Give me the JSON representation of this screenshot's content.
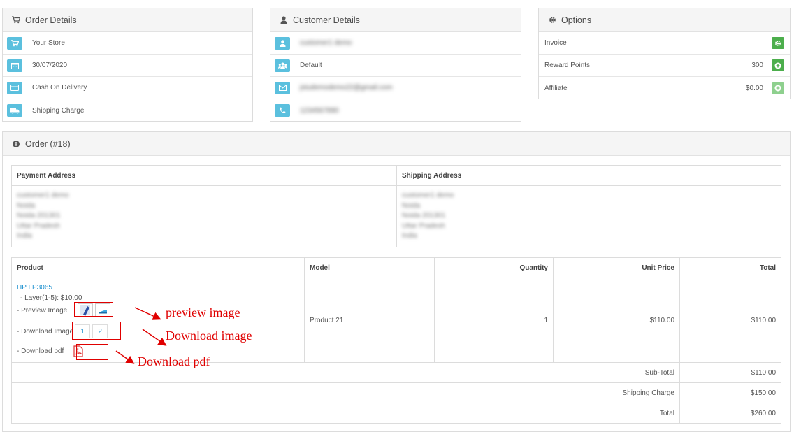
{
  "order_details": {
    "title": "Order Details",
    "store": "Your Store",
    "date": "30/07/2020",
    "payment_method": "Cash On Delivery",
    "shipping_method": "Shipping Charge"
  },
  "customer_details": {
    "title": "Customer Details",
    "name": "customer1 demo",
    "group": "Default",
    "email": "jstudemodemo22@gmail.com",
    "phone": "1234567890"
  },
  "options": {
    "title": "Options",
    "invoice_label": "Invoice",
    "reward_label": "Reward Points",
    "reward_value": "300",
    "affiliate_label": "Affiliate",
    "affiliate_value": "$0.00"
  },
  "order": {
    "title": "Order (#18)",
    "payment_address_header": "Payment Address",
    "shipping_address_header": "Shipping Address",
    "payment_address_lines": [
      "customer1 demo",
      "Noida",
      "Noida 201301",
      "Uttar Pradesh",
      "India"
    ],
    "shipping_address_lines": [
      "customer1 demo",
      "Noida",
      "Noida 201301",
      "Uttar Pradesh",
      "India"
    ],
    "columns": {
      "product": "Product",
      "model": "Model",
      "quantity": "Quantity",
      "unit_price": "Unit Price",
      "total": "Total"
    },
    "item": {
      "name": "HP LP3065",
      "option": "- Layer(1-5): $10.00",
      "preview_label": "- Preview Image",
      "download_image_label": "- Download Image",
      "download_links": [
        "1",
        "2"
      ],
      "download_pdf_label": "- Download pdf",
      "model": "Product 21",
      "quantity": "1",
      "unit_price": "$110.00",
      "total": "$110.00"
    },
    "totals": [
      {
        "label": "Sub-Total",
        "value": "$110.00"
      },
      {
        "label": "Shipping Charge",
        "value": "$150.00"
      },
      {
        "label": "Total",
        "value": "$260.00"
      }
    ]
  },
  "annotations": {
    "preview": "preview image",
    "download_image": "Download image",
    "download_pdf": "Download pdf"
  }
}
